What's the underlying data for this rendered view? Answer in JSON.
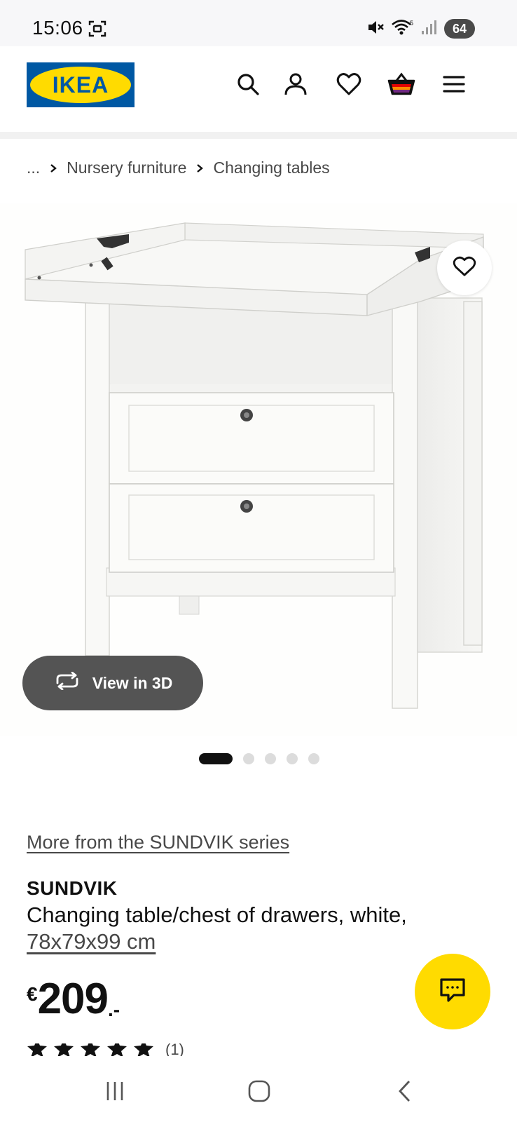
{
  "status_bar": {
    "time": "15:06",
    "battery": "64",
    "icons": [
      "screenshot-icon",
      "mute-icon",
      "wifi-icon",
      "signal-icon"
    ]
  },
  "header": {
    "logo_text": "IKEA",
    "icons": [
      "search-icon",
      "account-icon",
      "favourites-icon",
      "cart-icon",
      "menu-icon"
    ]
  },
  "breadcrumb": {
    "ellipsis": "...",
    "items": [
      "Nursery furniture",
      "Changing tables"
    ]
  },
  "gallery": {
    "view_3d_label": "View in 3D",
    "slide_count": 5,
    "active_slide": 1
  },
  "product": {
    "series_link": "More from the SUNDVIK series",
    "name": "SUNDVIK",
    "description": "Changing table/chest of drawers, white,",
    "dimensions": "78x79x99 cm",
    "price": {
      "currency": "€",
      "amount": "209",
      "suffix": ".-"
    },
    "rating": {
      "stars": 5,
      "count": "(1)"
    }
  },
  "colors": {
    "ikea_blue": "#0058a3",
    "ikea_yellow": "#ffdb00",
    "text_dark": "#111111",
    "text_muted": "#484848"
  }
}
